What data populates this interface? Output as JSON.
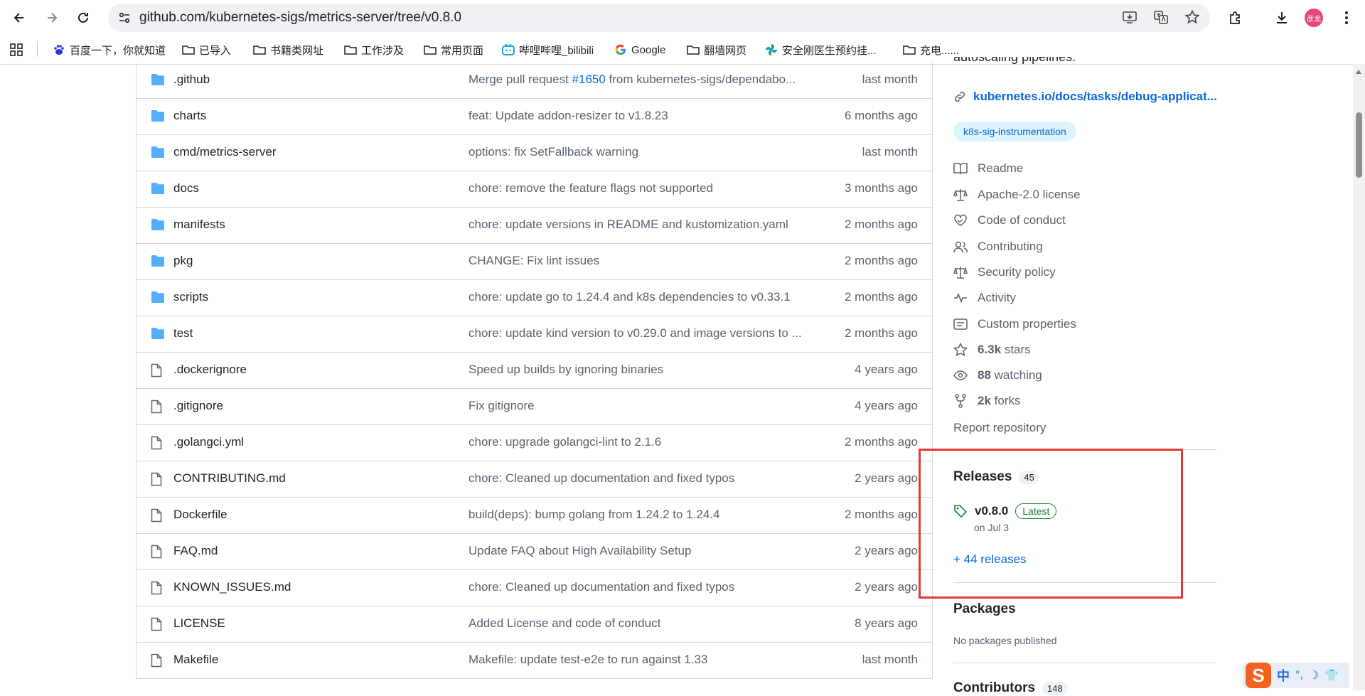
{
  "browser": {
    "url": "github.com/kubernetes-sigs/metrics-server/tree/v0.8.0",
    "profile_avatar": "彦龙",
    "bookmarks": [
      {
        "label": "百度一下，你就知道",
        "icon": "baidu-paw-icon"
      },
      {
        "label": "已导入",
        "icon": "folder-icon"
      },
      {
        "label": "书籍类网址",
        "icon": "folder-icon"
      },
      {
        "label": "工作涉及",
        "icon": "folder-icon"
      },
      {
        "label": "常用页面",
        "icon": "folder-icon"
      },
      {
        "label": "哔哩哔哩_bilibili",
        "icon": "bilibili-tv-icon"
      },
      {
        "label": "Google",
        "icon": "google-g-icon"
      },
      {
        "label": "翻墙网页",
        "icon": "folder-icon"
      },
      {
        "label": "安全刚医生预约挂...",
        "icon": "pinwheel-icon"
      },
      {
        "label": "充电......",
        "icon": "folder-icon"
      }
    ]
  },
  "files": [
    {
      "name": ".github",
      "type": "dir",
      "message_pre": "Merge pull request ",
      "message_link": "#1650",
      "message_post": " from kubernetes-sigs/dependabo...",
      "time": "last month"
    },
    {
      "name": "charts",
      "type": "dir",
      "message": "feat: Update addon-resizer to v1.8.23",
      "time": "6 months ago"
    },
    {
      "name": "cmd/metrics-server",
      "type": "dir",
      "message": "options: fix SetFallback warning",
      "time": "last month"
    },
    {
      "name": "docs",
      "type": "dir",
      "message": "chore: remove the feature flags not supported",
      "time": "3 months ago"
    },
    {
      "name": "manifests",
      "type": "dir",
      "message": "chore: update versions in README and kustomization.yaml",
      "time": "2 months ago"
    },
    {
      "name": "pkg",
      "type": "dir",
      "message": "CHANGE: Fix lint issues",
      "time": "2 months ago"
    },
    {
      "name": "scripts",
      "type": "dir",
      "message": "chore: update go to 1.24.4 and k8s dependencies to v0.33.1",
      "time": "2 months ago"
    },
    {
      "name": "test",
      "type": "dir",
      "message": "chore: update kind version to v0.29.0 and image versions to ...",
      "time": "2 months ago"
    },
    {
      "name": ".dockerignore",
      "type": "file",
      "message": "Speed up builds by ignoring binaries",
      "time": "4 years ago"
    },
    {
      "name": ".gitignore",
      "type": "file",
      "message": "Fix gitignore",
      "time": "4 years ago"
    },
    {
      "name": ".golangci.yml",
      "type": "file",
      "message": "chore: upgrade golangci-lint to 2.1.6",
      "time": "2 months ago"
    },
    {
      "name": "CONTRIBUTING.md",
      "type": "file",
      "message": "chore: Cleaned up documentation and fixed typos",
      "time": "2 years ago"
    },
    {
      "name": "Dockerfile",
      "type": "file",
      "message": "build(deps): bump golang from 1.24.2 to 1.24.4",
      "time": "2 months ago"
    },
    {
      "name": "FAQ.md",
      "type": "file",
      "message": "Update FAQ about High Availability Setup",
      "time": "2 years ago"
    },
    {
      "name": "KNOWN_ISSUES.md",
      "type": "file",
      "message": "chore: Cleaned up documentation and fixed typos",
      "time": "2 years ago"
    },
    {
      "name": "LICENSE",
      "type": "file",
      "message": "Added License and code of conduct",
      "time": "8 years ago"
    },
    {
      "name": "Makefile",
      "type": "file",
      "message": "Makefile: update test-e2e to run against 1.33",
      "time": "last month"
    }
  ],
  "about": {
    "description_cut": "autoscaling pipelines.",
    "website": "kubernetes.io/docs/tasks/debug-applicat...",
    "topic": "k8s-sig-instrumentation",
    "readme": "Readme",
    "license": "Apache-2.0 license",
    "code_of_conduct": "Code of conduct",
    "contributing": "Contributing",
    "security_policy": "Security policy",
    "activity": "Activity",
    "custom_properties": "Custom properties",
    "stars_count": "6.3k",
    "stars_label": "stars",
    "watching_count": "88",
    "watching_label": "watching",
    "forks_count": "2k",
    "forks_label": "forks",
    "report": "Report repository"
  },
  "releases": {
    "title": "Releases",
    "count": "45",
    "latest_tag": "v0.8.0",
    "latest_badge": "Latest",
    "latest_date": "on Jul 3",
    "more": "+ 44 releases"
  },
  "packages": {
    "title": "Packages",
    "note": "No packages published"
  },
  "contributors": {
    "title": "Contributors",
    "count": "148"
  },
  "ime": {
    "logo": "S",
    "mode": "中"
  },
  "colors": {
    "link": "#0969da",
    "highlight": "#e53935",
    "folder": "#54aeff",
    "latest": "#1a7f37"
  }
}
